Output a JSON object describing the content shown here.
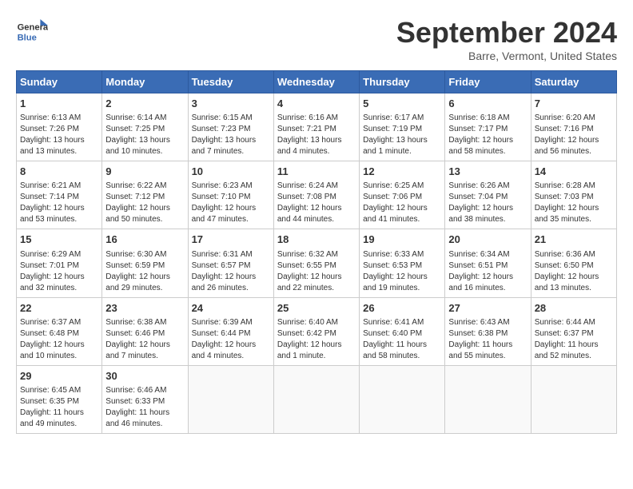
{
  "header": {
    "logo_line1": "General",
    "logo_line2": "Blue",
    "month": "September 2024",
    "location": "Barre, Vermont, United States"
  },
  "days_of_week": [
    "Sunday",
    "Monday",
    "Tuesday",
    "Wednesday",
    "Thursday",
    "Friday",
    "Saturday"
  ],
  "weeks": [
    [
      {
        "day": "1",
        "detail": "Sunrise: 6:13 AM\nSunset: 7:26 PM\nDaylight: 13 hours\nand 13 minutes."
      },
      {
        "day": "2",
        "detail": "Sunrise: 6:14 AM\nSunset: 7:25 PM\nDaylight: 13 hours\nand 10 minutes."
      },
      {
        "day": "3",
        "detail": "Sunrise: 6:15 AM\nSunset: 7:23 PM\nDaylight: 13 hours\nand 7 minutes."
      },
      {
        "day": "4",
        "detail": "Sunrise: 6:16 AM\nSunset: 7:21 PM\nDaylight: 13 hours\nand 4 minutes."
      },
      {
        "day": "5",
        "detail": "Sunrise: 6:17 AM\nSunset: 7:19 PM\nDaylight: 13 hours\nand 1 minute."
      },
      {
        "day": "6",
        "detail": "Sunrise: 6:18 AM\nSunset: 7:17 PM\nDaylight: 12 hours\nand 58 minutes."
      },
      {
        "day": "7",
        "detail": "Sunrise: 6:20 AM\nSunset: 7:16 PM\nDaylight: 12 hours\nand 56 minutes."
      }
    ],
    [
      {
        "day": "8",
        "detail": "Sunrise: 6:21 AM\nSunset: 7:14 PM\nDaylight: 12 hours\nand 53 minutes."
      },
      {
        "day": "9",
        "detail": "Sunrise: 6:22 AM\nSunset: 7:12 PM\nDaylight: 12 hours\nand 50 minutes."
      },
      {
        "day": "10",
        "detail": "Sunrise: 6:23 AM\nSunset: 7:10 PM\nDaylight: 12 hours\nand 47 minutes."
      },
      {
        "day": "11",
        "detail": "Sunrise: 6:24 AM\nSunset: 7:08 PM\nDaylight: 12 hours\nand 44 minutes."
      },
      {
        "day": "12",
        "detail": "Sunrise: 6:25 AM\nSunset: 7:06 PM\nDaylight: 12 hours\nand 41 minutes."
      },
      {
        "day": "13",
        "detail": "Sunrise: 6:26 AM\nSunset: 7:04 PM\nDaylight: 12 hours\nand 38 minutes."
      },
      {
        "day": "14",
        "detail": "Sunrise: 6:28 AM\nSunset: 7:03 PM\nDaylight: 12 hours\nand 35 minutes."
      }
    ],
    [
      {
        "day": "15",
        "detail": "Sunrise: 6:29 AM\nSunset: 7:01 PM\nDaylight: 12 hours\nand 32 minutes."
      },
      {
        "day": "16",
        "detail": "Sunrise: 6:30 AM\nSunset: 6:59 PM\nDaylight: 12 hours\nand 29 minutes."
      },
      {
        "day": "17",
        "detail": "Sunrise: 6:31 AM\nSunset: 6:57 PM\nDaylight: 12 hours\nand 26 minutes."
      },
      {
        "day": "18",
        "detail": "Sunrise: 6:32 AM\nSunset: 6:55 PM\nDaylight: 12 hours\nand 22 minutes."
      },
      {
        "day": "19",
        "detail": "Sunrise: 6:33 AM\nSunset: 6:53 PM\nDaylight: 12 hours\nand 19 minutes."
      },
      {
        "day": "20",
        "detail": "Sunrise: 6:34 AM\nSunset: 6:51 PM\nDaylight: 12 hours\nand 16 minutes."
      },
      {
        "day": "21",
        "detail": "Sunrise: 6:36 AM\nSunset: 6:50 PM\nDaylight: 12 hours\nand 13 minutes."
      }
    ],
    [
      {
        "day": "22",
        "detail": "Sunrise: 6:37 AM\nSunset: 6:48 PM\nDaylight: 12 hours\nand 10 minutes."
      },
      {
        "day": "23",
        "detail": "Sunrise: 6:38 AM\nSunset: 6:46 PM\nDaylight: 12 hours\nand 7 minutes."
      },
      {
        "day": "24",
        "detail": "Sunrise: 6:39 AM\nSunset: 6:44 PM\nDaylight: 12 hours\nand 4 minutes."
      },
      {
        "day": "25",
        "detail": "Sunrise: 6:40 AM\nSunset: 6:42 PM\nDaylight: 12 hours\nand 1 minute."
      },
      {
        "day": "26",
        "detail": "Sunrise: 6:41 AM\nSunset: 6:40 PM\nDaylight: 11 hours\nand 58 minutes."
      },
      {
        "day": "27",
        "detail": "Sunrise: 6:43 AM\nSunset: 6:38 PM\nDaylight: 11 hours\nand 55 minutes."
      },
      {
        "day": "28",
        "detail": "Sunrise: 6:44 AM\nSunset: 6:37 PM\nDaylight: 11 hours\nand 52 minutes."
      }
    ],
    [
      {
        "day": "29",
        "detail": "Sunrise: 6:45 AM\nSunset: 6:35 PM\nDaylight: 11 hours\nand 49 minutes."
      },
      {
        "day": "30",
        "detail": "Sunrise: 6:46 AM\nSunset: 6:33 PM\nDaylight: 11 hours\nand 46 minutes."
      },
      {
        "day": "",
        "detail": ""
      },
      {
        "day": "",
        "detail": ""
      },
      {
        "day": "",
        "detail": ""
      },
      {
        "day": "",
        "detail": ""
      },
      {
        "day": "",
        "detail": ""
      }
    ]
  ]
}
